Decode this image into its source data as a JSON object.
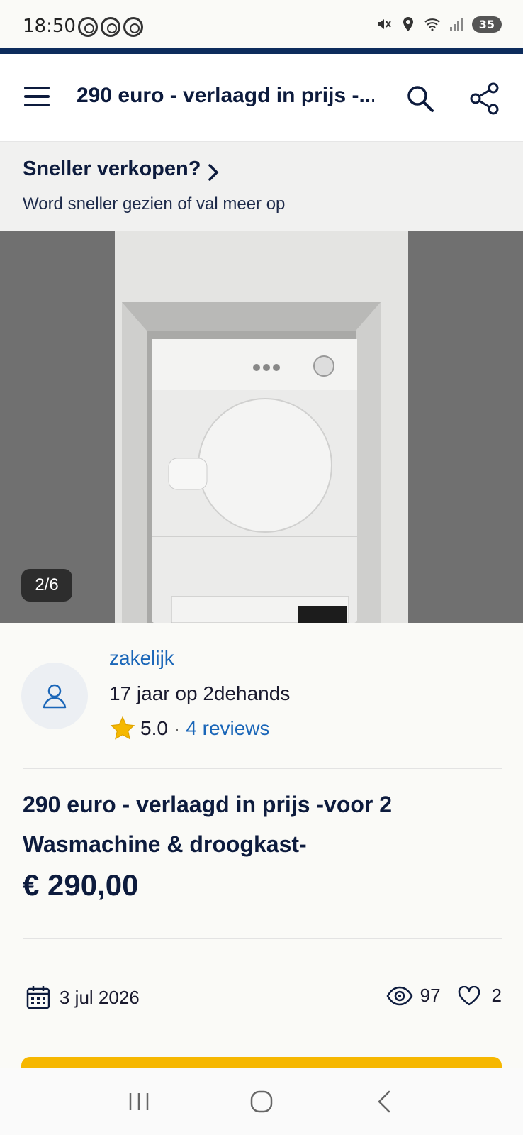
{
  "status_bar": {
    "time": "18:50",
    "battery": "35"
  },
  "header": {
    "title": "290 euro - verlaagd in prijs -..."
  },
  "promo": {
    "title": "Sneller verkopen?",
    "subtitle": "Word sneller gezien of val meer op"
  },
  "gallery": {
    "counter": "2/6"
  },
  "seller": {
    "name": "zakelijk",
    "years": "17 jaar op 2dehands",
    "rating": "5.0",
    "separator": "·",
    "reviews": "4 reviews"
  },
  "listing": {
    "title": "290 euro - verlaagd in prijs -voor 2 Wasmachine & droogkast-",
    "price": "€ 290,00",
    "date": "3 jul 2026",
    "views": "97",
    "favorites": "2"
  },
  "colors": {
    "brand_navy": "#0d2c5c",
    "link_blue": "#1a66b8",
    "cta_yellow": "#f6b700",
    "star": "#f5b800"
  },
  "icons": [
    "menu-icon",
    "search-icon",
    "share-icon",
    "chevron-right-icon",
    "user-icon",
    "star-icon",
    "calendar-icon",
    "eye-icon",
    "heart-icon"
  ]
}
